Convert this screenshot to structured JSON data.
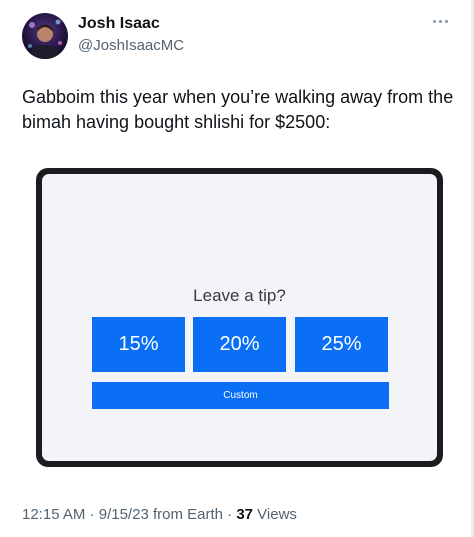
{
  "tweet": {
    "author": {
      "display_name": "Josh Isaac",
      "handle": "@JoshIsaacMC"
    },
    "text": "Gabboim this year when you’re walking away from the bimah having bought shlishi for $2500:",
    "meta": {
      "time": "12:15 AM",
      "separator": "·",
      "date": "9/15/23 from Earth",
      "views_count": "37",
      "views_label": "Views"
    }
  },
  "media": {
    "prompt": "Leave a tip?",
    "tip_options": [
      "15%",
      "20%",
      "25%"
    ],
    "custom_label": "Custom"
  },
  "icons": {
    "more": "more-horizontal-icon"
  },
  "colors": {
    "tip_button": "#0a6ff5",
    "screen_background": "#f2f4f7",
    "device_frame": "#1b1c20",
    "secondary_text": "#536471"
  }
}
